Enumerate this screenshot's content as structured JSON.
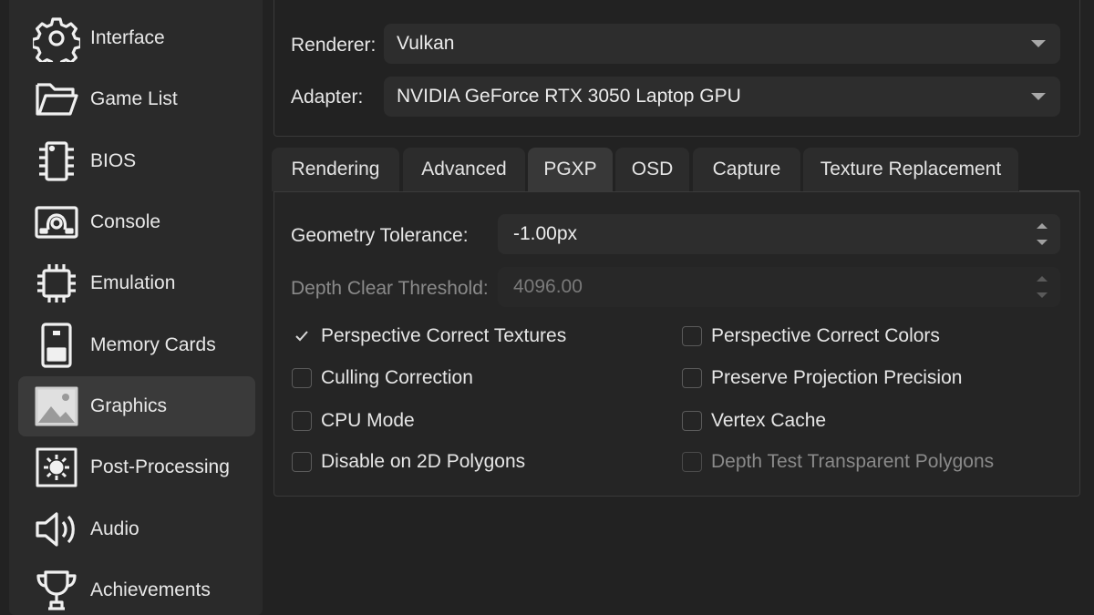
{
  "sidebar": {
    "items": [
      {
        "label": "Interface",
        "icon": "gear-icon"
      },
      {
        "label": "Game List",
        "icon": "folder-icon"
      },
      {
        "label": "BIOS",
        "icon": "chip-icon"
      },
      {
        "label": "Console",
        "icon": "console-icon"
      },
      {
        "label": "Emulation",
        "icon": "cpu-icon"
      },
      {
        "label": "Memory Cards",
        "icon": "memory-card-icon"
      },
      {
        "label": "Graphics",
        "icon": "image-icon"
      },
      {
        "label": "Post-Processing",
        "icon": "brightness-icon"
      },
      {
        "label": "Audio",
        "icon": "speaker-icon"
      },
      {
        "label": "Achievements",
        "icon": "trophy-icon"
      }
    ],
    "active": "Graphics"
  },
  "renderer": {
    "label": "Renderer:",
    "value": "Vulkan"
  },
  "adapter": {
    "label": "Adapter:",
    "value": "NVIDIA GeForce RTX 3050 Laptop GPU"
  },
  "tabs": [
    "Rendering",
    "Advanced",
    "PGXP",
    "OSD",
    "Capture",
    "Texture Replacement"
  ],
  "active_tab": "PGXP",
  "pgxp": {
    "geometry_tolerance": {
      "label": "Geometry Tolerance:",
      "value": "-1.00px"
    },
    "depth_clear_threshold": {
      "label": "Depth Clear Threshold:",
      "value": "4096.00"
    },
    "options": [
      {
        "label": "Perspective Correct Textures",
        "checked": true,
        "enabled": true
      },
      {
        "label": "Perspective Correct Colors",
        "checked": false,
        "enabled": true
      },
      {
        "label": "Culling Correction",
        "checked": false,
        "enabled": true
      },
      {
        "label": "Preserve Projection Precision",
        "checked": false,
        "enabled": true
      },
      {
        "label": "CPU Mode",
        "checked": false,
        "enabled": true
      },
      {
        "label": "Vertex Cache",
        "checked": false,
        "enabled": true
      },
      {
        "label": "Disable on 2D Polygons",
        "checked": false,
        "enabled": true
      },
      {
        "label": "Depth Test Transparent Polygons",
        "checked": false,
        "enabled": false
      }
    ]
  },
  "colors": {
    "background": "#222222",
    "panel": "#2a2a2a",
    "active_item": "#3a3a3a",
    "text": "#e6e6e6",
    "disabled_text": "#7a7a7a"
  }
}
